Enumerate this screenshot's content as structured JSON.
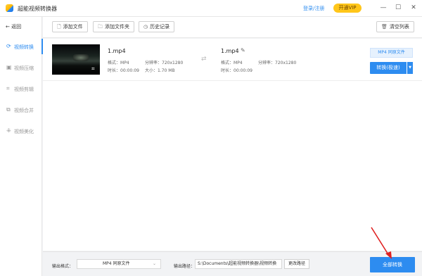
{
  "app": {
    "title": "超能视频转换器",
    "login": "登录/注册",
    "vip": "开通VIP"
  },
  "window": {
    "min": "—",
    "max": "☐",
    "close": "✕"
  },
  "sidebar": {
    "back": "返回",
    "items": [
      {
        "label": "视频转换",
        "icon": "convert-icon",
        "active": true
      },
      {
        "label": "视频压缩",
        "icon": "compress-icon"
      },
      {
        "label": "视频剪辑",
        "icon": "crop-icon"
      },
      {
        "label": "视频合并",
        "icon": "merge-icon"
      },
      {
        "label": "视频美化",
        "icon": "beautify-icon"
      }
    ]
  },
  "toolbar": {
    "add_file": "添加文件",
    "add_folder": "添加文件夹",
    "history": "历史记录",
    "clear_list": "清空列表"
  },
  "file": {
    "src": {
      "name": "1.mp4",
      "format_label": "格式：",
      "format": "MP4",
      "res_label": "分辨率：",
      "res": "720x1280",
      "duration_label": "时长：",
      "duration": "00:00:09",
      "size_label": "大小：",
      "size": "1.70 MB"
    },
    "dst": {
      "name": "1.mp4",
      "format_label": "格式：",
      "format": "MP4",
      "res_label": "分辨率：",
      "res": "720x1280",
      "duration_label": "时长：",
      "duration": "00:00:09"
    },
    "target_format": "MP4 同原文件",
    "convert_label": "转换(极速)"
  },
  "bottom": {
    "output_format_label": "输出格式：",
    "output_format": "MP4 同原文件",
    "output_path_label": "输出路径：",
    "output_path": "S:\\Documents\\超能视频转换器\\视频转换",
    "change_path": "更改路径",
    "convert_all": "全部转换"
  },
  "colors": {
    "accent": "#2d8cf0",
    "vip": "#ffc61a",
    "annotation": "#e02020"
  }
}
